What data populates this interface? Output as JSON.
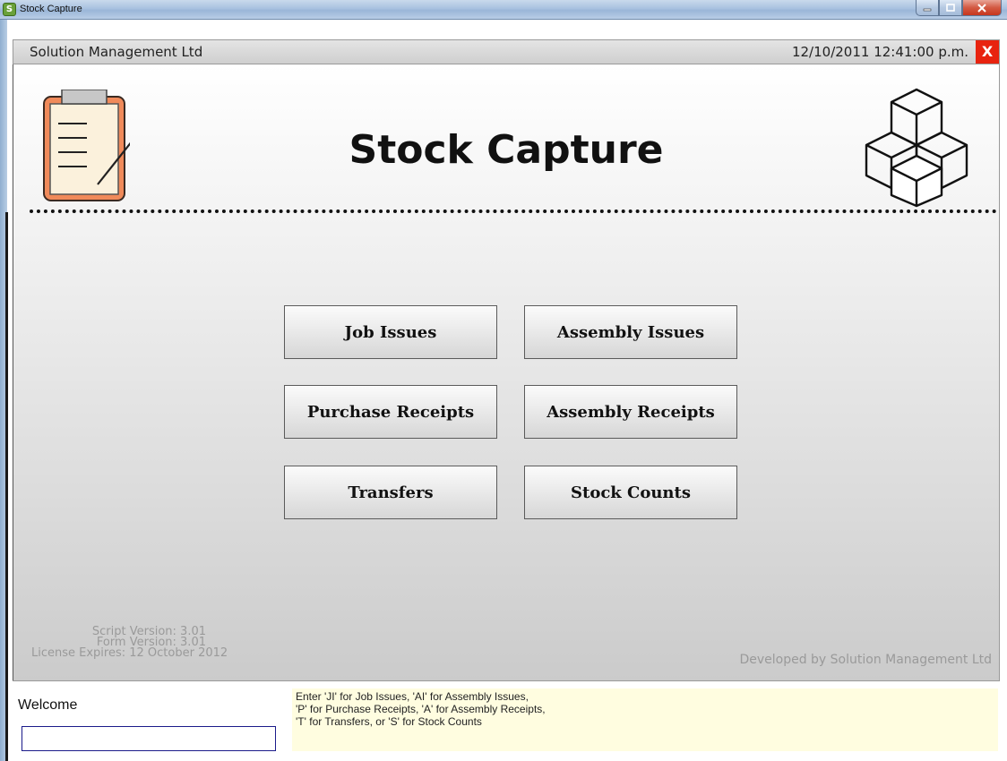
{
  "window": {
    "title": "Stock Capture",
    "app_icon": "stock-capture-app-icon",
    "controls": [
      "minimize",
      "maximize",
      "close"
    ]
  },
  "header": {
    "company": "Solution Management Ltd",
    "datetime": "12/10/2011 12:41:00 p.m.",
    "close_label": "X",
    "close_color": "#e8230f"
  },
  "main": {
    "title": "Stock Capture",
    "left_icon": "clipboard-icon",
    "right_icon": "stacked-boxes-icon",
    "buttons": [
      {
        "label": "Job Issues"
      },
      {
        "label": "Assembly Issues"
      },
      {
        "label": "Purchase Receipts"
      },
      {
        "label": "Assembly Receipts"
      },
      {
        "label": "Transfers"
      },
      {
        "label": "Stock Counts"
      }
    ],
    "script_version": "Script Version: 3.01",
    "form_version": "Form Version: 3.01",
    "license_expires": "License Expires: 12 October 2012",
    "developed_by": "Developed by Solution Management Ltd"
  },
  "footer": {
    "welcome": "Welcome",
    "input_value": "",
    "hint_lines": [
      "Enter 'JI' for Job Issues, 'AI' for Assembly Issues,",
      "'P' for Purchase Receipts, 'A' for Assembly Receipts,",
      "'T' for Transfers, or 'S' for Stock Counts"
    ],
    "hint_bg": "#fffde0"
  }
}
